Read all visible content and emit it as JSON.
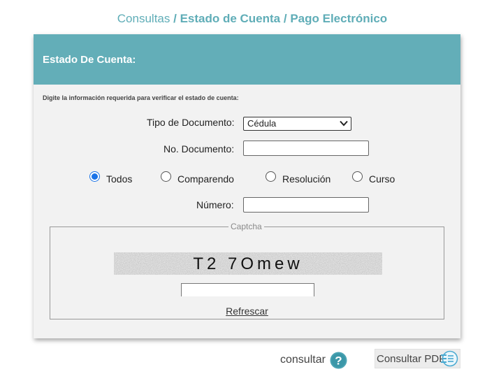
{
  "breadcrumb": {
    "root": "Consultas",
    "sep1": " / ",
    "mid": "Estado de Cuenta",
    "sep2": " / ",
    "current": "Pago Electrónico"
  },
  "panel": {
    "title": "Estado De Cuenta:",
    "instructions": "Digite la información requerida para verificar el estado de cuenta:"
  },
  "form": {
    "doc_type_label": "Tipo de Documento:",
    "doc_type_value": "Cédula",
    "doc_number_label": "No. Documento:",
    "doc_number_value": "",
    "numero_label": "Número:",
    "numero_value": "",
    "radios": [
      {
        "label": "Todos",
        "checked": true
      },
      {
        "label": "Comparendo",
        "checked": false
      },
      {
        "label": "Resolución",
        "checked": false
      },
      {
        "label": "Curso",
        "checked": false
      }
    ]
  },
  "captcha": {
    "legend": "Captcha",
    "code": "T2 7Omew",
    "refresh_label": "Refrescar",
    "input_value": ""
  },
  "actions": {
    "consultar_label": "consultar",
    "consultar_pdf_label": "Consultar PDF"
  },
  "colors": {
    "accent": "#63aeb8",
    "breadcrumb": "#5fadb7",
    "radio_checked": "#1a73e8",
    "help_icon": "#4aa3b3"
  }
}
